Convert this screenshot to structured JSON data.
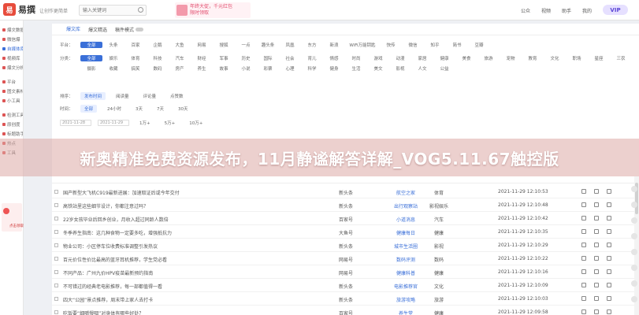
{
  "header": {
    "logo_mark": "易",
    "logo_text": "易撰",
    "logo_sub": "让创作更简单",
    "search_placeholder": "输入关键词",
    "banner_line1": "年终大促，千元红包",
    "banner_line2": "限时领取",
    "nav": [
      "公众",
      "视频",
      "助手",
      "我的"
    ],
    "vip": "VIP"
  },
  "sidebar": {
    "items": [
      {
        "label": "爆文数据",
        "active": false
      },
      {
        "label": "微信爆",
        "active": false
      },
      {
        "label": "自媒体库",
        "active": true
      },
      {
        "label": "视频库",
        "active": false
      },
      {
        "label": "爆文分析",
        "active": false
      },
      {
        "label": "平台",
        "active": false
      },
      {
        "label": "图文素材",
        "active": false
      },
      {
        "label": "小工具",
        "active": false
      },
      {
        "label": "检测工具",
        "active": false
      },
      {
        "label": "原创度",
        "active": false
      },
      {
        "label": "标题助手",
        "active": false
      },
      {
        "label": "热点",
        "active": false
      },
      {
        "label": "工具",
        "active": false
      }
    ],
    "badge": "NEW",
    "promo": "点击领取"
  },
  "main": {
    "tabs": [
      {
        "label": "爆文库",
        "active": true
      },
      {
        "label": "爆文精选",
        "active": false
      },
      {
        "label": "稿件模式",
        "active": false
      }
    ],
    "platform_label": "平台：",
    "platforms": [
      "全部",
      "头条",
      "百家",
      "企鹅",
      "大鱼",
      "网易",
      "搜狐",
      "一点",
      "趣头条",
      "凤凰",
      "东方",
      "新浪",
      "WiFi万能钥匙",
      "快传",
      "微信",
      "知乎",
      "简书",
      "豆瓣"
    ],
    "category_label": "分类：",
    "categories": [
      "全部",
      "娱乐",
      "体育",
      "科技",
      "汽车",
      "财经",
      "军事",
      "历史",
      "国际",
      "社会",
      "育儿",
      "情感",
      "时尚",
      "游戏",
      "动漫",
      "家居",
      "健康",
      "美食",
      "旅游",
      "宠物",
      "教育",
      "文化",
      "职场",
      "星座",
      "三农",
      "摄影",
      "收藏",
      "搞笑",
      "数码",
      "房产",
      "养生",
      "故事",
      "小说",
      "彩票",
      "心理",
      "科学",
      "健身",
      "生活",
      "美文",
      "影视",
      "人文",
      "公益"
    ],
    "sort_label": "排序：",
    "sorts": [
      "发布时间",
      "阅读量",
      "评论量",
      "点赞数"
    ],
    "time_label": "时间：",
    "times": [
      "全部",
      "24小时",
      "3天",
      "7天",
      "30天"
    ],
    "date_from": "2021-11-28",
    "date_to": "2021-11-29",
    "ranges": [
      "1万+",
      "5万+",
      "10万+"
    ]
  },
  "overlay_title": "新奥精准免费资源发布，11月静谧解答详解_VOG5.11.67触控版",
  "table": {
    "rows": [
      {
        "title": "国产新型大飞机C919最新进展：加速取证后或今年交付",
        "author": "新头条",
        "account": "航空之家",
        "category": "体育",
        "time": "2021-11-29 12:10:53"
      },
      {
        "title": "高铁站里这些细节设计，你都注意过吗？",
        "author": "新头条",
        "account": "出行观察站",
        "category": "影视娱乐",
        "time": "2021-11-29 12:10:48"
      },
      {
        "title": "22岁女孩毕业后回乡创业，月收入超过同龄人数倍",
        "author": "百家号",
        "account": "小道消息",
        "category": "汽车",
        "time": "2021-11-29 12:10:42"
      },
      {
        "title": "冬季养生指南：这几种食物一定要多吃，增强抵抗力",
        "author": "大鱼号",
        "account": "健康每日",
        "category": "健康",
        "time": "2021-11-29 12:10:35"
      },
      {
        "title": "物业公司：小区停车位收费标准调整引发热议",
        "author": "新头条",
        "account": "城市生活圈",
        "category": "影视",
        "time": "2021-11-29 12:10:29"
      },
      {
        "title": "百元价位性价比最高的蓝牙耳机推荐，学生党必看",
        "author": "网易号",
        "account": "数码评测",
        "category": "数码",
        "time": "2021-11-29 12:10:22"
      },
      {
        "title": "不同产品：广州九价HPV疫苗最新预约指南",
        "author": "网易号",
        "account": "健康科普",
        "category": "健康",
        "time": "2021-11-29 12:10:16"
      },
      {
        "title": "不可错过的经典老电影推荐，每一部都值得一看",
        "author": "新头条",
        "account": "电影推荐官",
        "category": "文化",
        "time": "2021-11-29 12:10:09"
      },
      {
        "title": "四大“公园”景点推荐，周末带上家人去打卡",
        "author": "新头条",
        "account": "旅游攻略",
        "category": "旅游",
        "time": "2021-11-29 12:10:03"
      },
      {
        "title": "吃饭要“细嚼慢咽”对身体有哪些好处？",
        "author": "百家号",
        "account": "养生堂",
        "category": "健康",
        "time": "2021-11-29 12:09:58"
      }
    ]
  },
  "colors": {
    "accent": "#3a6fd8",
    "brand": "#e74c3c",
    "overlay": "#dcaaa5"
  }
}
